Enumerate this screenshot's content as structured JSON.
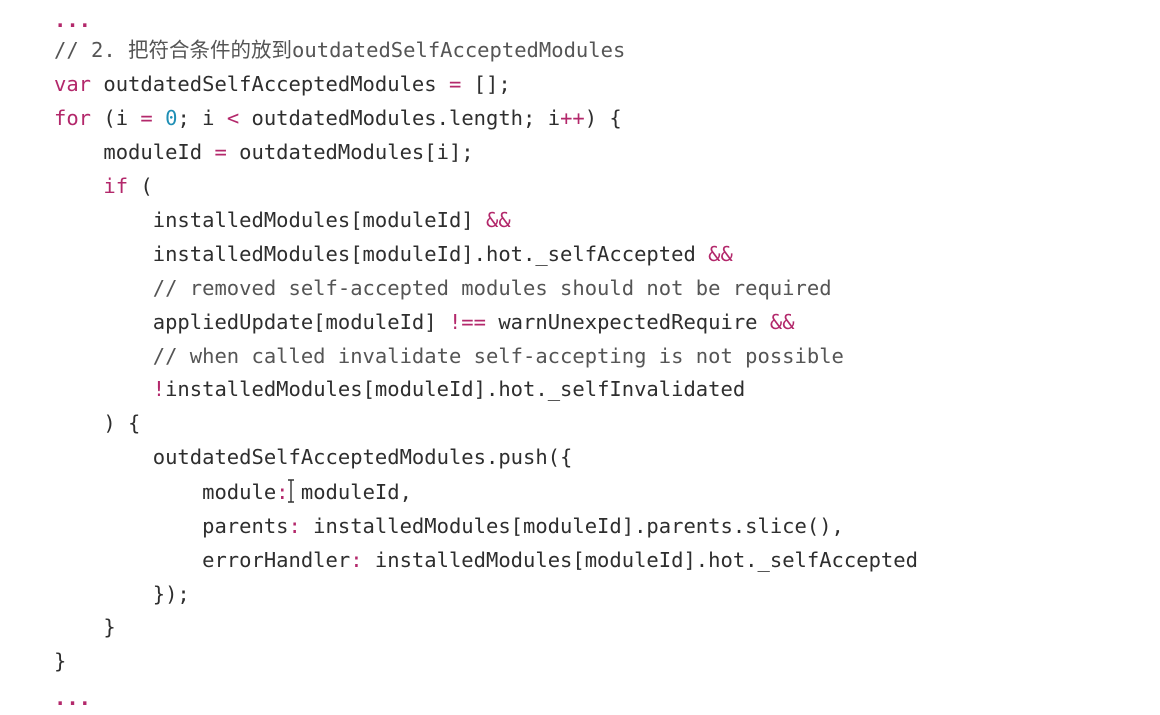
{
  "code": {
    "lines": [
      {
        "tokens": [
          {
            "t": "...",
            "k": "ellipsis"
          }
        ]
      },
      {
        "tokens": [
          {
            "t": "// 2. 把符合条件的放到outdatedSelfAcceptedModules",
            "k": "comment"
          }
        ]
      },
      {
        "tokens": [
          {
            "t": "var",
            "k": "keyword"
          },
          {
            "t": " outdatedSelfAcceptedModules ",
            "k": "plain"
          },
          {
            "t": "=",
            "k": "op"
          },
          {
            "t": " [];",
            "k": "plain"
          }
        ]
      },
      {
        "tokens": [
          {
            "t": "for",
            "k": "keyword"
          },
          {
            "t": " (i ",
            "k": "plain"
          },
          {
            "t": "=",
            "k": "op"
          },
          {
            "t": " ",
            "k": "plain"
          },
          {
            "t": "0",
            "k": "number"
          },
          {
            "t": "; i ",
            "k": "plain"
          },
          {
            "t": "<",
            "k": "op"
          },
          {
            "t": " outdatedModules.length; i",
            "k": "plain"
          },
          {
            "t": "++",
            "k": "op"
          },
          {
            "t": ") {",
            "k": "plain"
          }
        ]
      },
      {
        "tokens": [
          {
            "t": "    moduleId ",
            "k": "plain"
          },
          {
            "t": "=",
            "k": "op"
          },
          {
            "t": " outdatedModules[i];",
            "k": "plain"
          }
        ]
      },
      {
        "tokens": [
          {
            "t": "    ",
            "k": "plain"
          },
          {
            "t": "if",
            "k": "keyword"
          },
          {
            "t": " (",
            "k": "plain"
          }
        ]
      },
      {
        "tokens": [
          {
            "t": "        installedModules[moduleId] ",
            "k": "plain"
          },
          {
            "t": "&&",
            "k": "op"
          }
        ]
      },
      {
        "tokens": [
          {
            "t": "        installedModules[moduleId].hot._selfAccepted ",
            "k": "plain"
          },
          {
            "t": "&&",
            "k": "op"
          }
        ]
      },
      {
        "tokens": [
          {
            "t": "        // removed self-accepted modules should not be required",
            "k": "comment"
          }
        ]
      },
      {
        "tokens": [
          {
            "t": "        appliedUpdate[moduleId] ",
            "k": "plain"
          },
          {
            "t": "!==",
            "k": "op"
          },
          {
            "t": " warnUnexpectedRequire ",
            "k": "plain"
          },
          {
            "t": "&&",
            "k": "op"
          }
        ]
      },
      {
        "tokens": [
          {
            "t": "        // when called invalidate self-accepting is not possible",
            "k": "comment"
          }
        ]
      },
      {
        "tokens": [
          {
            "t": "        ",
            "k": "plain"
          },
          {
            "t": "!",
            "k": "op"
          },
          {
            "t": "installedModules[moduleId].hot._selfInvalidated",
            "k": "plain"
          }
        ]
      },
      {
        "tokens": [
          {
            "t": "    ) {",
            "k": "plain"
          }
        ]
      },
      {
        "tokens": [
          {
            "t": "        outdatedSelfAcceptedModules.push({",
            "k": "plain"
          }
        ]
      },
      {
        "tokens": [
          {
            "t": "            module",
            "k": "prop"
          },
          {
            "t": ":",
            "k": "op"
          },
          {
            "t": " moduleId,",
            "k": "plain"
          }
        ]
      },
      {
        "tokens": [
          {
            "t": "            parents",
            "k": "prop"
          },
          {
            "t": ":",
            "k": "op"
          },
          {
            "t": " installedModules[moduleId].parents.slice(),",
            "k": "plain"
          }
        ]
      },
      {
        "tokens": [
          {
            "t": "            errorHandler",
            "k": "prop"
          },
          {
            "t": ":",
            "k": "op"
          },
          {
            "t": " installedModules[moduleId].hot._selfAccepted",
            "k": "plain"
          }
        ]
      },
      {
        "tokens": [
          {
            "t": "        });",
            "k": "plain"
          }
        ]
      },
      {
        "tokens": [
          {
            "t": "    }",
            "k": "plain"
          }
        ]
      },
      {
        "tokens": [
          {
            "t": "}",
            "k": "plain"
          }
        ]
      },
      {
        "tokens": [
          {
            "t": "...",
            "k": "ellipsis"
          }
        ]
      }
    ]
  },
  "cursor": {
    "icon": "text-cursor-icon"
  },
  "colors": {
    "background": "#ffffff",
    "text": "#2e2e2e",
    "keyword": "#b3286b",
    "number": "#1f8fb5",
    "comment": "#555555"
  }
}
